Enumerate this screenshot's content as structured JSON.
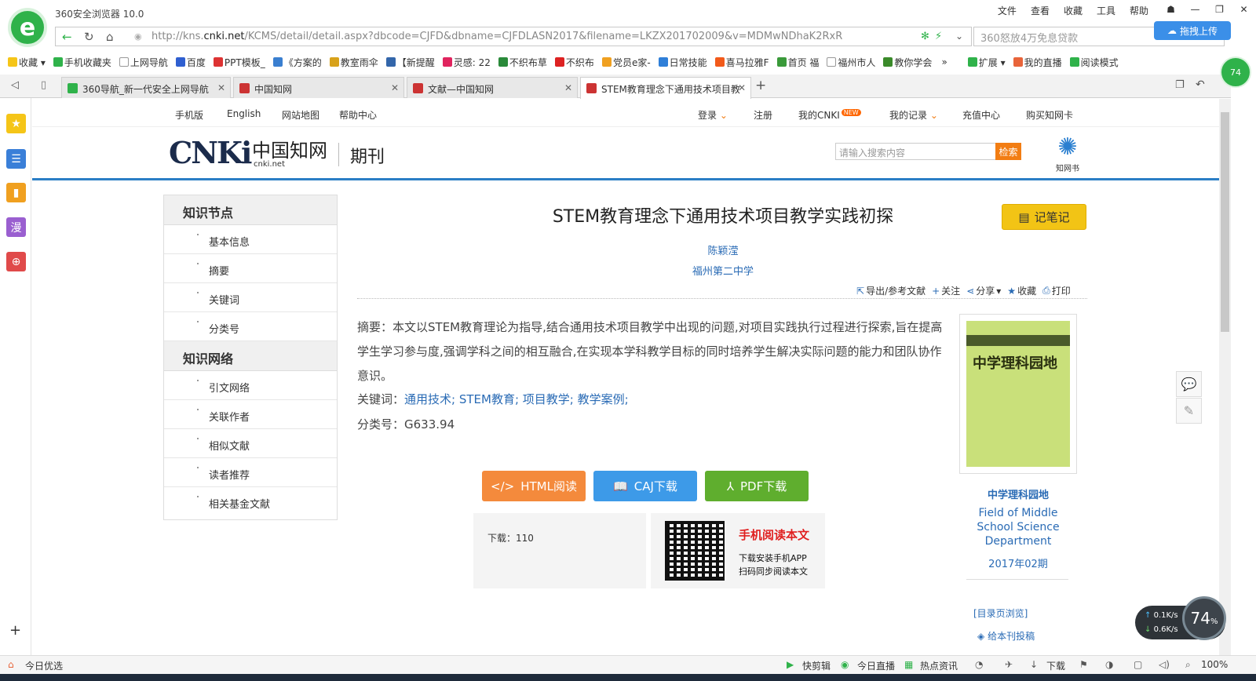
{
  "browser": {
    "app_title": "360安全浏览器 10.0",
    "menu": [
      "文件",
      "查看",
      "收藏",
      "工具",
      "帮助"
    ],
    "url_prefix": "http://kns.",
    "url_domain": "cnki.net",
    "url_rest": "/KCMS/detail/detail.aspx?dbcode=CJFD&dbname=CJFDLASN2017&filename=LKZX201702009&v=MDMwNDhaK2RxRnI6aFVyckl",
    "search_placeholder": "360怒放4万免息贷款",
    "upload_label": "拖拽上传",
    "side_bubble": "74",
    "bookmarks": [
      "收藏",
      "手机收藏夹",
      "上网导航",
      "百度",
      "PPT模板_",
      "《方案的",
      "教室雨伞",
      "【新提醒",
      "灵感: 22",
      "不织布草",
      "不织布",
      "党员e家-",
      "日常技能",
      "喜马拉雅F",
      "首页 福",
      "福州市人",
      "教你学会",
      "扩展",
      "我的直播",
      "阅读模式"
    ],
    "tabs": [
      {
        "label": "360导航_新一代安全上网导航"
      },
      {
        "label": "中国知网"
      },
      {
        "label": "文献—中国知网"
      },
      {
        "label": "STEM教育理念下通用技术项目教"
      }
    ],
    "status_left": "今日优选",
    "status_items": [
      "快剪辑",
      "今日直播",
      "热点资讯",
      "下载",
      "100%"
    ],
    "net": {
      "up": "0.1K/s",
      "down": "0.6K/s",
      "percent": "74",
      "unit": "%"
    }
  },
  "site": {
    "topnav": [
      "手机版",
      "English",
      "网站地图",
      "帮助中心"
    ],
    "topnav_right": [
      "登录",
      "注册",
      "我的CNKI",
      "我的记录",
      "充值中心",
      "购买知网卡"
    ],
    "new_badge": "NEW",
    "logo_text": "CNKi",
    "logo_cn": "中国知网",
    "logo_net": "cnki.net",
    "section": "期刊",
    "search_placeholder": "请输入搜索内容",
    "search_button": "检索",
    "zhiwang_label": "知网书"
  },
  "sidebar": {
    "section1_title": "知识节点",
    "section1_items": [
      "基本信息",
      "摘要",
      "关键词",
      "分类号"
    ],
    "section2_title": "知识网络",
    "section2_items": [
      "引文网络",
      "关联作者",
      "相似文献",
      "读者推荐",
      "相关基金文献"
    ]
  },
  "article": {
    "title": "STEM教育理念下通用技术项目教学实践初探",
    "note_button": "记笔记",
    "author": "陈颖滢",
    "organization": "福州第二中学",
    "tools": [
      "导出/参考文献",
      "关注",
      "分享",
      "收藏",
      "打印"
    ],
    "abstract_label": "摘要：",
    "abstract": "本文以STEM教育理论为指导,结合通用技术项目教学中出现的问题,对项目实践执行过程进行探索,旨在提高学生学习参与度,强调学科之间的相互融合,在实现本学科教学目标的同时培养学生解决实际问题的能力和团队协作意识。",
    "keywords_label": "关键词：",
    "keywords": "通用技术; STEM教育; 项目教学; 教学案例;",
    "class_label": "分类号：",
    "class_no": "G633.94",
    "buttons": {
      "html": "HTML阅读",
      "caj": "CAJ下载",
      "pdf": "PDF下载"
    },
    "download_label": "下载：",
    "download_count": "110",
    "mobile_title": "手机阅读本文",
    "mobile_line1": "下载安装手机APP",
    "mobile_line2": "扫码同步阅读本文"
  },
  "journal": {
    "cover_title": "中学理科园地",
    "name_cn": "中学理科园地",
    "name_en": "Field of Middle School Science Department",
    "issue": "2017年02期",
    "catalog_link": "[目录页浏览]",
    "submit_link": "给本刊投稿"
  },
  "colors": {
    "accent_blue": "#2b7ec5",
    "html_btn": "#f48a3c",
    "caj_btn": "#3d9ae8",
    "pdf_btn": "#5fae2e",
    "note_btn": "#f2c415"
  }
}
